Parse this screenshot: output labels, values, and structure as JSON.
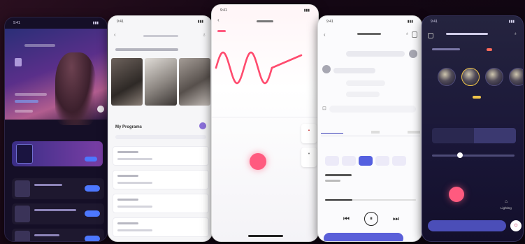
{
  "colors": {
    "background": "#150714",
    "accent_pink": "#ff5a7f",
    "accent_blue": "#4d78ff",
    "accent_indigo": "#5a5fd9"
  },
  "phone1": {
    "time": "9:41"
  },
  "phone2": {
    "time": "9:41",
    "section_title": "My Programs"
  },
  "phone3": {
    "time": "9:41"
  },
  "phone4": {
    "time": "9:41",
    "controls": {
      "prev": "⏮",
      "pause": "⏸",
      "next": "⏭"
    }
  },
  "phone5": {
    "time": "9:41",
    "lighting_label": "Lighting"
  },
  "wave": {
    "color": "#ff4b6e",
    "cycles": 2.5
  }
}
